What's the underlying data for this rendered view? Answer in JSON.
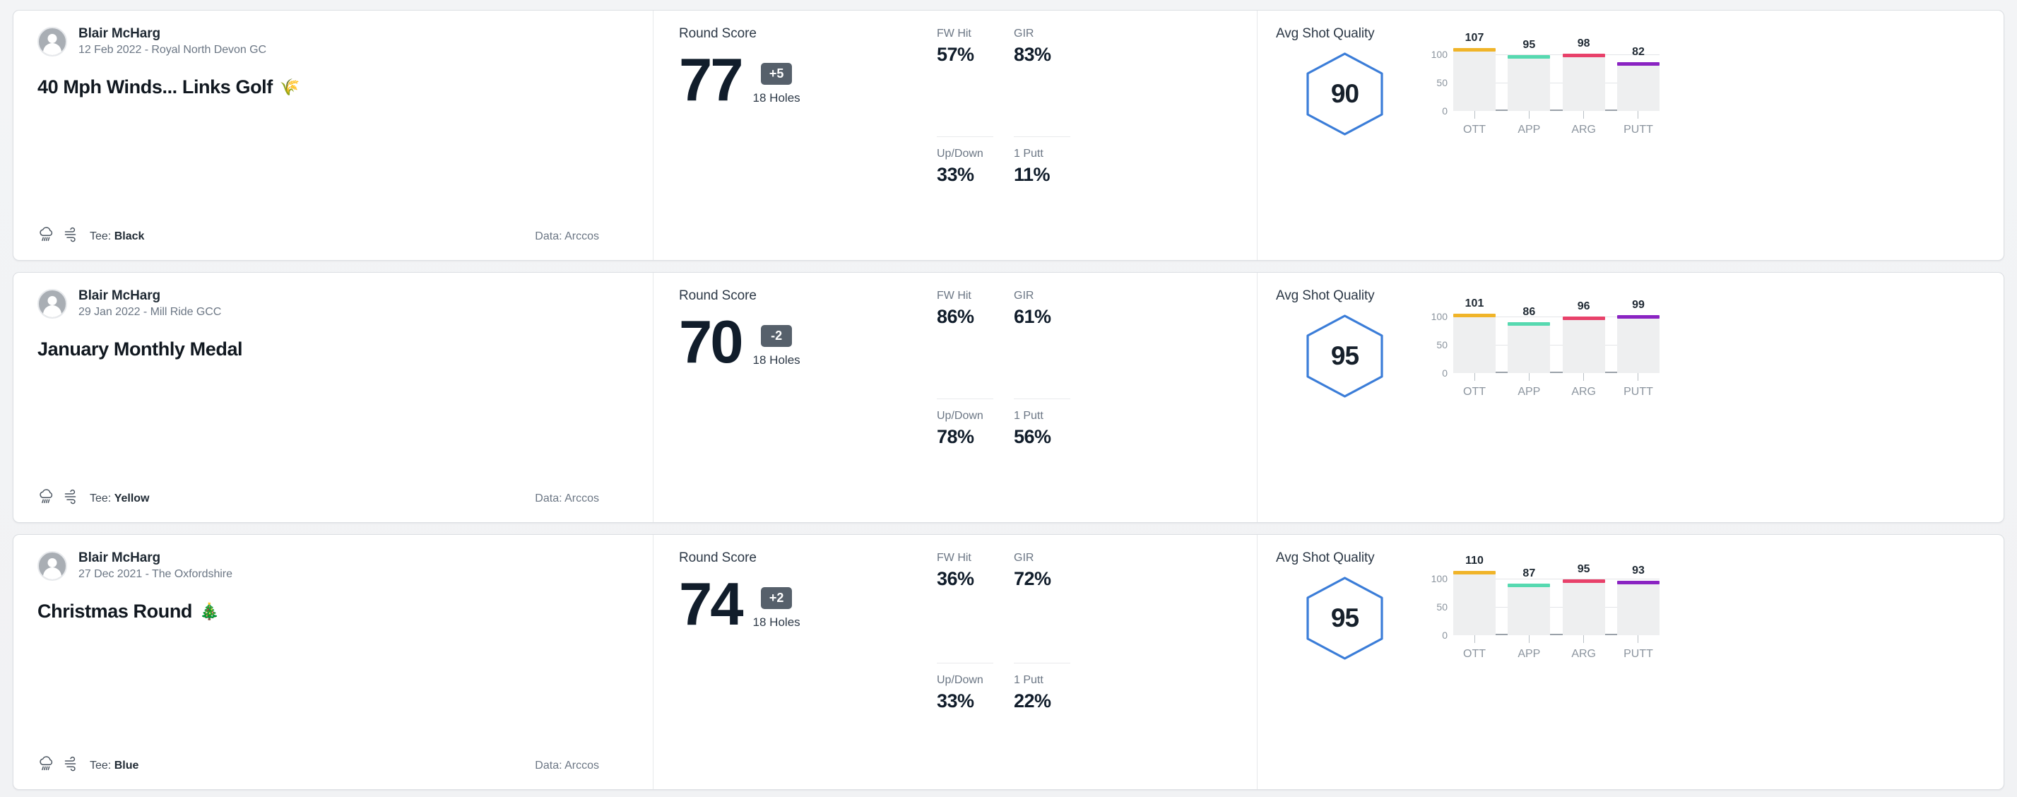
{
  "page": {
    "background": "#f2f3f5",
    "card_background": "#ffffff"
  },
  "labels": {
    "round_score": "Round Score",
    "holes": "18 Holes",
    "avg_shot_quality": "Avg Shot Quality",
    "fw_hit": "FW Hit",
    "gir": "GIR",
    "up_down": "Up/Down",
    "one_putt": "1 Putt",
    "tee_prefix": "Tee:",
    "data_prefix": "Data:"
  },
  "chart_colors": {
    "OTT": "#f0b429",
    "APP": "#56d9b0",
    "ARG": "#e8416a",
    "PUTT": "#8a23c2",
    "bar_track": "#eeeff0",
    "hexagon_stroke": "#3b7dd8",
    "axis": "#9aa1a9",
    "grid": "#e3e5e8"
  },
  "rounds": [
    {
      "player": "Blair McHarg",
      "meta": "12 Feb 2022 - Royal North Devon GC",
      "title": "40 Mph Winds... Links Golf",
      "title_emoji": "🌾",
      "weather_icons": [
        "rain-cloud-icon",
        "wind-icon"
      ],
      "tee": "Black",
      "data_source": "Arccos",
      "score": "77",
      "to_par": "+5",
      "holes": "18 Holes",
      "stats": {
        "fw_hit": "57%",
        "gir": "83%",
        "up_down": "33%",
        "one_putt": "11%"
      },
      "shot_quality": "90",
      "chart_data": {
        "type": "bar",
        "title": "Avg Shot Quality",
        "categories": [
          "OTT",
          "APP",
          "ARG",
          "PUTT"
        ],
        "values": [
          107,
          95,
          98,
          82
        ],
        "colors": [
          "#f0b429",
          "#56d9b0",
          "#e8416a",
          "#8a23c2"
        ],
        "yticks": [
          0,
          50,
          100
        ],
        "ylim": [
          0,
          115
        ],
        "xlabel": "",
        "ylabel": "",
        "grid": true,
        "legend": "none"
      }
    },
    {
      "player": "Blair McHarg",
      "meta": "29 Jan 2022 - Mill Ride GCC",
      "title": "January Monthly Medal",
      "title_emoji": "",
      "weather_icons": [
        "rain-cloud-icon",
        "wind-icon"
      ],
      "tee": "Yellow",
      "data_source": "Arccos",
      "score": "70",
      "to_par": "-2",
      "holes": "18 Holes",
      "stats": {
        "fw_hit": "86%",
        "gir": "61%",
        "up_down": "78%",
        "one_putt": "56%"
      },
      "shot_quality": "95",
      "chart_data": {
        "type": "bar",
        "title": "Avg Shot Quality",
        "categories": [
          "OTT",
          "APP",
          "ARG",
          "PUTT"
        ],
        "values": [
          101,
          86,
          96,
          99
        ],
        "colors": [
          "#f0b429",
          "#56d9b0",
          "#e8416a",
          "#8a23c2"
        ],
        "yticks": [
          0,
          50,
          100
        ],
        "ylim": [
          0,
          115
        ],
        "xlabel": "",
        "ylabel": "",
        "grid": true,
        "legend": "none"
      }
    },
    {
      "player": "Blair McHarg",
      "meta": "27 Dec 2021 - The Oxfordshire",
      "title": "Christmas Round",
      "title_emoji": "🎄",
      "weather_icons": [
        "rain-cloud-icon",
        "wind-icon"
      ],
      "tee": "Blue",
      "data_source": "Arccos",
      "score": "74",
      "to_par": "+2",
      "holes": "18 Holes",
      "stats": {
        "fw_hit": "36%",
        "gir": "72%",
        "up_down": "33%",
        "one_putt": "22%"
      },
      "shot_quality": "95",
      "chart_data": {
        "type": "bar",
        "title": "Avg Shot Quality",
        "categories": [
          "OTT",
          "APP",
          "ARG",
          "PUTT"
        ],
        "values": [
          110,
          87,
          95,
          93
        ],
        "colors": [
          "#f0b429",
          "#56d9b0",
          "#e8416a",
          "#8a23c2"
        ],
        "yticks": [
          0,
          50,
          100
        ],
        "ylim": [
          0,
          115
        ],
        "xlabel": "",
        "ylabel": "",
        "grid": true,
        "legend": "none"
      }
    }
  ]
}
